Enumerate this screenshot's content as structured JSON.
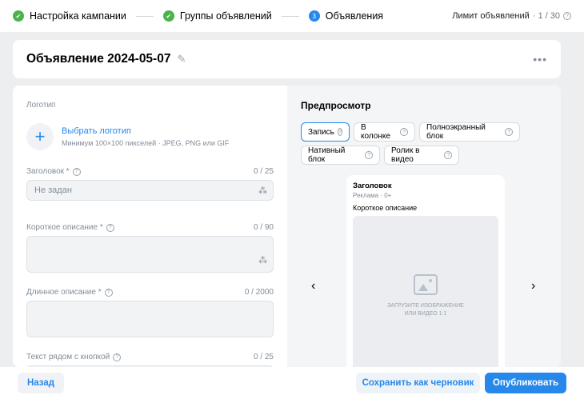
{
  "stepper": {
    "steps": [
      {
        "label": "Настройка кампании",
        "status": "done",
        "icon": "check-icon"
      },
      {
        "label": "Группы объявлений",
        "status": "done",
        "icon": "check-icon"
      },
      {
        "label": "Объявления",
        "status": "active",
        "number": "3"
      }
    ],
    "limit_label": "Лимит объявлений",
    "limit_value": "· 1 / 30"
  },
  "ad": {
    "title": "Объявление 2024-05-07"
  },
  "form": {
    "logo": {
      "label": "Логотип",
      "link": "Выбрать логотип",
      "hint": "Минимум 100×100 пикселей · JPEG, PNG или GIF"
    },
    "headline": {
      "label": "Заголовок *",
      "counter": "0 / 25",
      "placeholder": "Не задан"
    },
    "short_description": {
      "label": "Короткое описание *",
      "counter": "0 / 90"
    },
    "long_description": {
      "label": "Длинное описание *",
      "counter": "0 / 2000"
    },
    "button_text": {
      "label": "Текст рядом с кнопкой",
      "counter": "0 / 25"
    }
  },
  "preview": {
    "title": "Предпросмотр",
    "formats": [
      {
        "label": "Запись",
        "active": true
      },
      {
        "label": "В колонке",
        "active": false
      },
      {
        "label": "Полноэкранный блок",
        "active": false
      },
      {
        "label": "Нативный блок",
        "active": false
      },
      {
        "label": "Ролик в видео",
        "active": false
      }
    ],
    "card": {
      "headline": "Заголовок",
      "meta": "Реклама · 0+",
      "description": "Короткое описание",
      "media_text": "ЗАГРУЗИТЕ ИЗОБРАЖЕНИЕ ИЛИ ВИДЕО 1:1"
    }
  },
  "footer": {
    "back": "Назад",
    "save_draft": "Сохранить как черновик",
    "publish": "Опубликовать"
  },
  "colors": {
    "accent": "#2688eb",
    "success": "#4bb34b"
  }
}
